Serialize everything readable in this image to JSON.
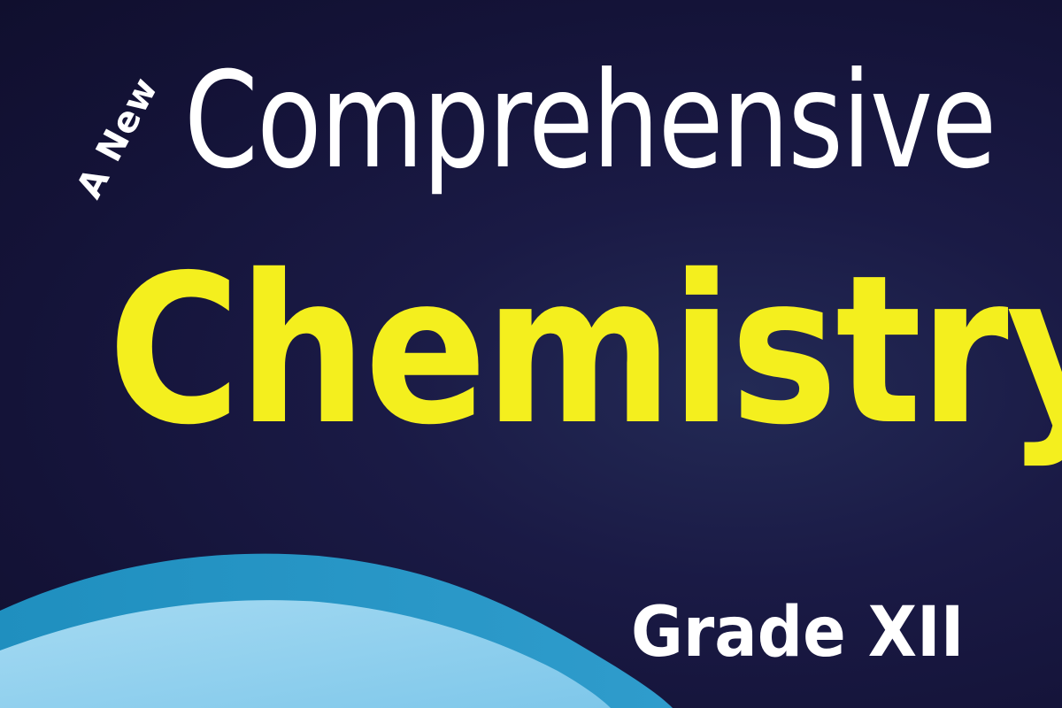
{
  "cover": {
    "prefix": "A New",
    "title_top": "Comprehensive",
    "title_main": "Chemistry",
    "grade": "Grade XII"
  },
  "colors": {
    "background": "#15143a",
    "title_top": "#ffffff",
    "title_main": "#f4ef1e",
    "grade": "#ffffff",
    "wave_outer": "#2a8fc0",
    "wave_inner": "#8fd0ee"
  }
}
